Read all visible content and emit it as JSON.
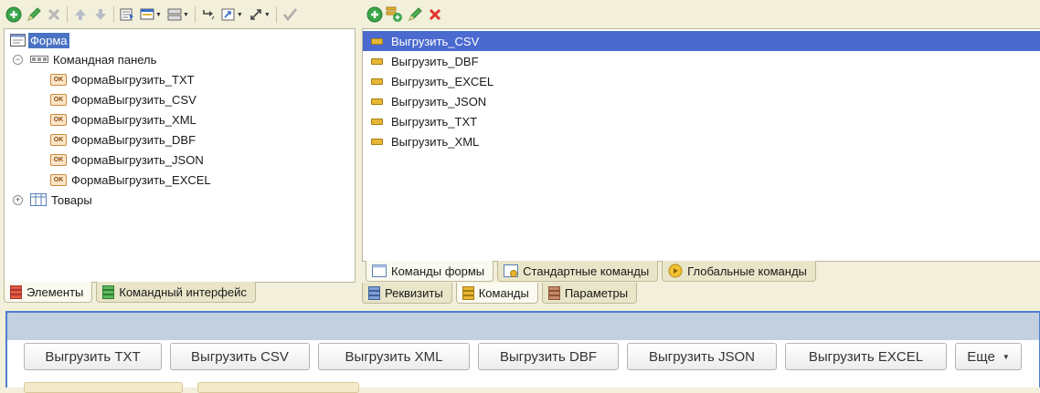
{
  "left_tree": {
    "root": "Форма",
    "command_panel": "Командная панель",
    "commands": [
      "ФормаВыгрузить_TXT",
      "ФормаВыгрузить_CSV",
      "ФормаВыгрузить_XML",
      "ФормаВыгрузить_DBF",
      "ФормаВыгрузить_JSON",
      "ФормаВыгрузить_EXCEL"
    ],
    "table": "Товары",
    "ok_badge": "OK"
  },
  "left_tabs": {
    "elements": "Элементы",
    "command_interface": "Командный интерфейс"
  },
  "right_list": {
    "items": [
      "Выгрузить_CSV",
      "Выгрузить_DBF",
      "Выгрузить_EXCEL",
      "Выгрузить_JSON",
      "Выгрузить_TXT",
      "Выгрузить_XML"
    ]
  },
  "right_subtabs": {
    "form_commands": "Команды формы",
    "standard_commands": "Стандартные команды",
    "global_commands": "Глобальные команды"
  },
  "right_tabs": {
    "attributes": "Реквизиты",
    "commands": "Команды",
    "parameters": "Параметры"
  },
  "preview": {
    "buttons": [
      "Выгрузить TXT",
      "Выгрузить CSV",
      "Выгрузить XML",
      "Выгрузить DBF",
      "Выгрузить JSON",
      "Выгрузить EXCEL"
    ],
    "more": "Еще"
  },
  "colors": {
    "selection": "#4b6ad0",
    "panel_bg": "#f2efda",
    "preview_border": "#4e7fd0",
    "preview_bar": "#c3d0e0"
  }
}
